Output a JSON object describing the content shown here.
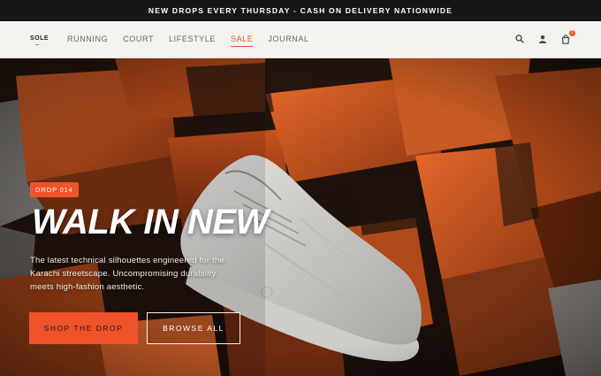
{
  "announcement": "NEW DROPS EVERY THURSDAY - CASH ON DELIVERY NATIONWIDE",
  "nav": {
    "logo": "SOLE",
    "links": [
      {
        "label": "RUNNING"
      },
      {
        "label": "COURT"
      },
      {
        "label": "LIFESTYLE"
      },
      {
        "label": "SALE",
        "active": true
      },
      {
        "label": "JOURNAL"
      }
    ],
    "cart_count": "2"
  },
  "hero": {
    "tag": "DROP 014",
    "headline": "WALK IN NEW",
    "subtext": "The latest technical silhouettes engineered for the Karachi streetscape. Uncompromising durability meets high-fashion aesthetic.",
    "primary_cta": "SHOP THE DROP",
    "secondary_cta": "BROWSE ALL"
  },
  "colors": {
    "accent": "#f0522a",
    "announcement_bg": "#161616",
    "nav_bg": "#f4f2ee"
  },
  "icons": [
    "search-icon",
    "account-icon",
    "cart-icon"
  ]
}
